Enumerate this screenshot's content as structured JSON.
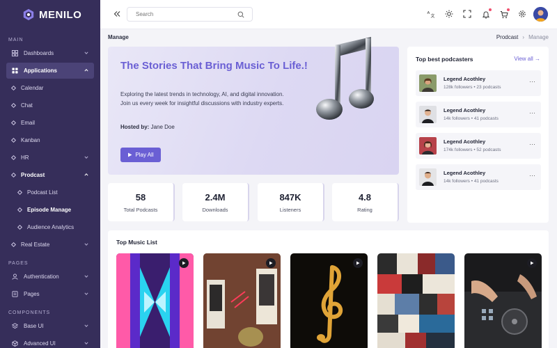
{
  "brand": {
    "name": "MENILO"
  },
  "sidebar": {
    "main_title": "MAIN",
    "dashboards": "Dashboards",
    "applications": "Applications",
    "calendar": "Calendar",
    "chat": "Chat",
    "email": "Email",
    "kanban": "Kanban",
    "hr": "HR",
    "prodcast": "Prodcast",
    "podcast_list": "Podcast List",
    "episode_manage": "Episode Manage",
    "audience_analytics": "Audience Analytics",
    "real_estate": "Real Estate",
    "pages_title": "PAGES",
    "authentication": "Authentication",
    "pages": "Pages",
    "components_title": "COMPONENTS",
    "base_ui": "Base UI",
    "advanced_ui": "Advanced UI"
  },
  "header": {
    "search_placeholder": "Search",
    "notification_dot_color": "#f0506e"
  },
  "breadcrumb": {
    "page_title": "Manage",
    "parent": "Prodcast",
    "separator": "›",
    "current": "Manage"
  },
  "hero": {
    "title": "The Stories That Bring Music To Life.!",
    "description": "Exploring the latest trends in technology, AI, and digital innovation. Join us every week for insightful discussions with industry experts.",
    "hosted_label": "Hosted by:",
    "host_name": "Jane Doe",
    "play_label": "Play All"
  },
  "stats": [
    {
      "value": "58",
      "label": "Total Podcasts"
    },
    {
      "value": "2.4M",
      "label": "Downloads"
    },
    {
      "value": "847K",
      "label": "Listeners"
    },
    {
      "value": "4.8",
      "label": "Rating"
    }
  ],
  "podcasters": {
    "title": "Top best podcasters",
    "view_all": "View all →",
    "items": [
      {
        "name": "Legend Acothley",
        "meta": "128k followers • 23 podcasts"
      },
      {
        "name": "Legend Acothley",
        "meta": "14k followers • 41 podcasts"
      },
      {
        "name": "Legend Acothley",
        "meta": "174k followers • 52 podcasts"
      },
      {
        "name": "Legend Acothley",
        "meta": "14k followers • 41 podcasts"
      }
    ]
  },
  "music": {
    "title": "Top Music List"
  },
  "colors": {
    "accent": "#6a5fd4",
    "sidebar_bg": "#362e5a"
  }
}
